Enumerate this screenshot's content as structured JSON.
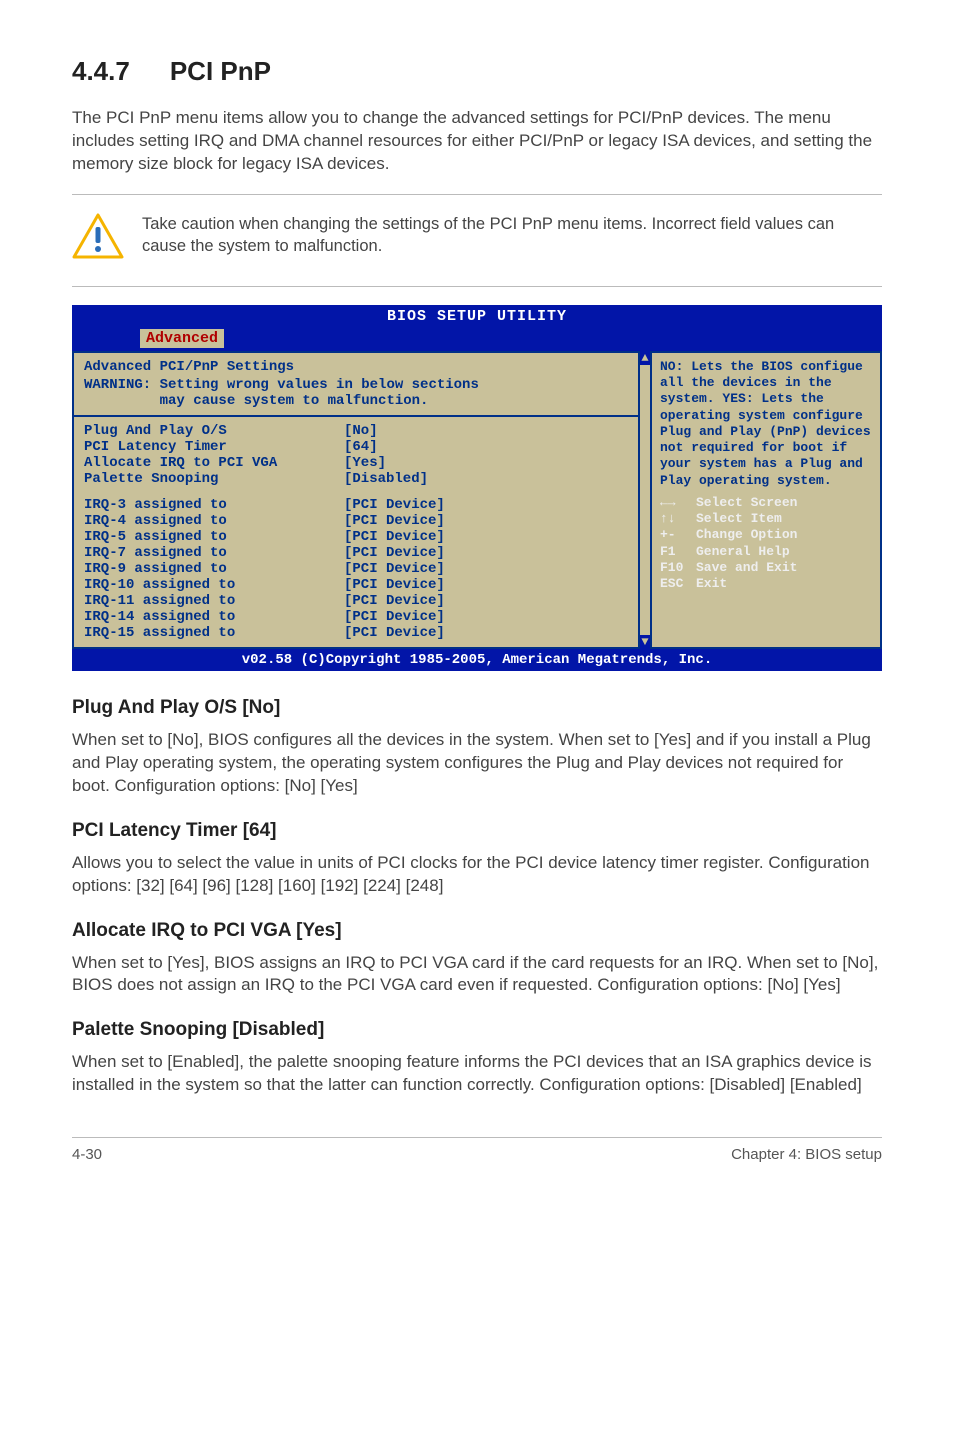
{
  "section": {
    "number": "4.4.7",
    "title": "PCI PnP"
  },
  "intro": "The PCI PnP menu items allow you to change the advanced settings for PCI/PnP devices. The menu includes setting IRQ and DMA channel resources for either PCI/PnP or legacy ISA devices, and setting the memory size block for legacy ISA devices.",
  "caution": "Take caution when changing the settings of the PCI PnP menu items. Incorrect field values can cause the system to malfunction.",
  "bios": {
    "title": "BIOS SETUP UTILITY",
    "tab": "Advanced",
    "heading": "Advanced PCI/PnP Settings",
    "warning_line1": "WARNING: Setting wrong values in below sections",
    "warning_line2": "         may cause system to malfunction.",
    "settings": [
      {
        "label": "Plug And Play O/S",
        "value": "[No]"
      },
      {
        "label": "PCI Latency Timer",
        "value": "[64]"
      },
      {
        "label": "Allocate IRQ to PCI VGA",
        "value": "[Yes]"
      },
      {
        "label": "Palette Snooping",
        "value": "[Disabled]"
      }
    ],
    "irqs": [
      {
        "label": "IRQ-3 assigned to",
        "value": "[PCI Device]"
      },
      {
        "label": "IRQ-4 assigned to",
        "value": "[PCI Device]"
      },
      {
        "label": "IRQ-5 assigned to",
        "value": "[PCI Device]"
      },
      {
        "label": "IRQ-7 assigned to",
        "value": "[PCI Device]"
      },
      {
        "label": "IRQ-9 assigned to",
        "value": "[PCI Device]"
      },
      {
        "label": "IRQ-10 assigned to",
        "value": "[PCI Device]"
      },
      {
        "label": "IRQ-11 assigned to",
        "value": "[PCI Device]"
      },
      {
        "label": "IRQ-14 assigned to",
        "value": "[PCI Device]"
      },
      {
        "label": "IRQ-15 assigned to",
        "value": "[PCI Device]"
      }
    ],
    "help_desc": "NO: Lets the BIOS configue all the devices in the system. YES: Lets the operating system configure Plug and Play (PnP) devices not required for boot if your system has a Plug and Play operating system.",
    "keys": [
      {
        "k": "←→",
        "t": "Select Screen"
      },
      {
        "k": "↑↓",
        "t": "Select Item"
      },
      {
        "k": "+-",
        "t": "Change Option"
      },
      {
        "k": "F1",
        "t": "General Help"
      },
      {
        "k": "F10",
        "t": "Save and Exit"
      },
      {
        "k": "ESC",
        "t": "Exit"
      }
    ],
    "footer": "v02.58 (C)Copyright 1985-2005, American Megatrends, Inc."
  },
  "subsections": [
    {
      "heading": "Plug And Play O/S [No]",
      "body": "When set to [No], BIOS configures all the devices in the system. When set to [Yes] and if you install a Plug and Play operating system, the operating system configures the Plug and Play devices not required for boot. Configuration options: [No] [Yes]"
    },
    {
      "heading": "PCI Latency Timer [64]",
      "body": "Allows you to select the value in units of PCI clocks for the PCI device latency timer register. Configuration options: [32] [64] [96] [128] [160] [192] [224] [248]"
    },
    {
      "heading": "Allocate IRQ to PCI VGA [Yes]",
      "body": "When set to [Yes], BIOS assigns an IRQ to PCI VGA card if the card requests for an IRQ. When set to [No], BIOS does not assign an IRQ to the PCI VGA card even if requested. Configuration options: [No] [Yes]"
    },
    {
      "heading": "Palette Snooping [Disabled]",
      "body": "When set to [Enabled], the palette snooping feature informs the PCI devices that an ISA graphics device is installed in the system so that the latter can function correctly. Configuration options: [Disabled] [Enabled]"
    }
  ],
  "footer": {
    "left": "4-30",
    "right": "Chapter 4: BIOS setup"
  }
}
